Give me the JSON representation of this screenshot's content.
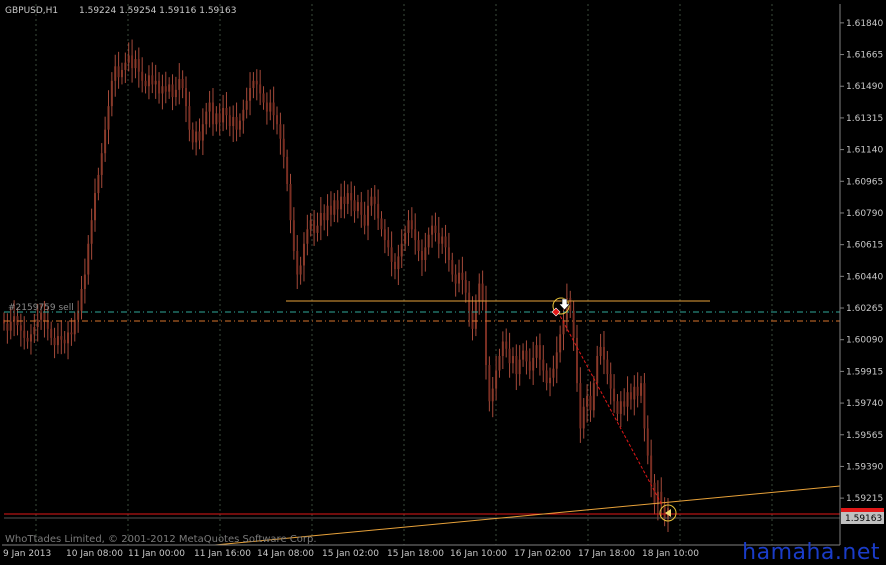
{
  "window": {
    "symbol_title": "GBPUSD,H1",
    "ohlc": "1.59224 1.59254 1.59116 1.59163",
    "copyright": "WhoTtades Limited, © 2001-2012 MetaQuotes Software Corp.",
    "watermark": "hamaha.net"
  },
  "order": {
    "label": "#2159759 sell",
    "open_price": 1.6024
  },
  "current_price_label": "1.59163",
  "colors": {
    "background": "#000000",
    "grid": "#3a4a3a",
    "axis": "#808080",
    "candle": "#7a2e22",
    "candle_wick": "#a54a3a",
    "order_line": "#2fa79a",
    "sl_line": "#d8732c",
    "horizontal_level": "#e8a23a",
    "trend_line": "#e8a23a",
    "bid_line": "#e01818",
    "trade_link": "#e01818",
    "price_label_bg": "#c0c0c0"
  },
  "chart_data": {
    "type": "candlestick",
    "timeframe": "H1",
    "y_ticks": [
      "1.61840",
      "1.61665",
      "1.61490",
      "1.61315",
      "1.61140",
      "1.60965",
      "1.60790",
      "1.60615",
      "1.60440",
      "1.60265",
      "1.60090",
      "1.59915",
      "1.59740",
      "1.59565",
      "1.59390",
      "1.59215",
      "1.59163"
    ],
    "ylim": [
      1.5905,
      1.619
    ],
    "x_ticks": [
      "9 Jan 2013",
      "10 Jan 08:00",
      "11 Jan 00:00",
      "11 Jan 16:00",
      "14 Jan 08:00",
      "15 Jan 02:00",
      "15 Jan 18:00",
      "16 Jan 10:00",
      "17 Jan 02:00",
      "17 Jan 18:00",
      "18 Jan 10:00"
    ],
    "close_series": [
      1.6018,
      1.6014,
      1.6019,
      1.6022,
      1.6017,
      1.6014,
      1.601,
      1.6008,
      1.6012,
      1.6016,
      1.602,
      1.6024,
      1.6019,
      1.6015,
      1.601,
      1.6006,
      1.6011,
      1.6009,
      1.6007,
      1.6013,
      1.6012,
      1.602,
      1.6025,
      1.6037,
      1.6045,
      1.6062,
      1.6075,
      1.609,
      1.61,
      1.6112,
      1.6125,
      1.6138,
      1.6152,
      1.616,
      1.6154,
      1.6158,
      1.6162,
      1.6166,
      1.6159,
      1.6164,
      1.6157,
      1.6152,
      1.6149,
      1.6155,
      1.615,
      1.6152,
      1.6145,
      1.6149,
      1.6146,
      1.615,
      1.6143,
      1.6147,
      1.6153,
      1.6148,
      1.6138,
      1.6125,
      1.6118,
      1.6124,
      1.6119,
      1.6128,
      1.6135,
      1.614,
      1.6128,
      1.6134,
      1.6129,
      1.6137,
      1.6133,
      1.6127,
      1.6132,
      1.6125,
      1.613,
      1.6136,
      1.6141,
      1.6148,
      1.6152,
      1.615,
      1.6145,
      1.614,
      1.6135,
      1.614,
      1.6133,
      1.6128,
      1.612,
      1.611,
      1.6095,
      1.6075,
      1.6058,
      1.6045,
      1.605,
      1.6062,
      1.607,
      1.6075,
      1.6068,
      1.6072,
      1.6079,
      1.6075,
      1.6083,
      1.6078,
      1.6086,
      1.6081,
      1.6088,
      1.6084,
      1.609,
      1.6086,
      1.608,
      1.6085,
      1.6078,
      1.6072,
      1.6083,
      1.6088,
      1.6084,
      1.6076,
      1.607,
      1.6064,
      1.606,
      1.6052,
      1.6048,
      1.6055,
      1.6062,
      1.6068,
      1.6075,
      1.607,
      1.6064,
      1.6058,
      1.6053,
      1.606,
      1.6067,
      1.6072,
      1.6068,
      1.6062,
      1.6066,
      1.606,
      1.6053,
      1.6045,
      1.604,
      1.6046,
      1.6042,
      1.6035,
      1.6025,
      1.6015,
      1.603,
      1.604,
      1.603,
      1.5995,
      1.5975,
      1.5982,
      1.5992,
      1.6,
      1.6008,
      1.6004,
      1.5996,
      1.6,
      1.599,
      1.5998,
      1.6003,
      1.5997,
      1.5992,
      1.5999,
      1.6006,
      1.5998,
      1.5992,
      1.5985,
      1.5988,
      1.5993,
      1.6002,
      1.6012,
      1.602,
      1.6032,
      1.6025,
      1.601,
      1.5985,
      1.596,
      1.5972,
      1.5978,
      1.597,
      1.5985,
      1.6,
      1.6005,
      1.5998,
      1.599,
      1.5982,
      1.5975,
      1.5968,
      1.5975,
      1.5972,
      1.598,
      1.5976,
      1.5983,
      1.5978,
      1.5985,
      1.596,
      1.5945,
      1.593,
      1.5918,
      1.5925,
      1.5918,
      1.591,
      1.5916
    ]
  }
}
